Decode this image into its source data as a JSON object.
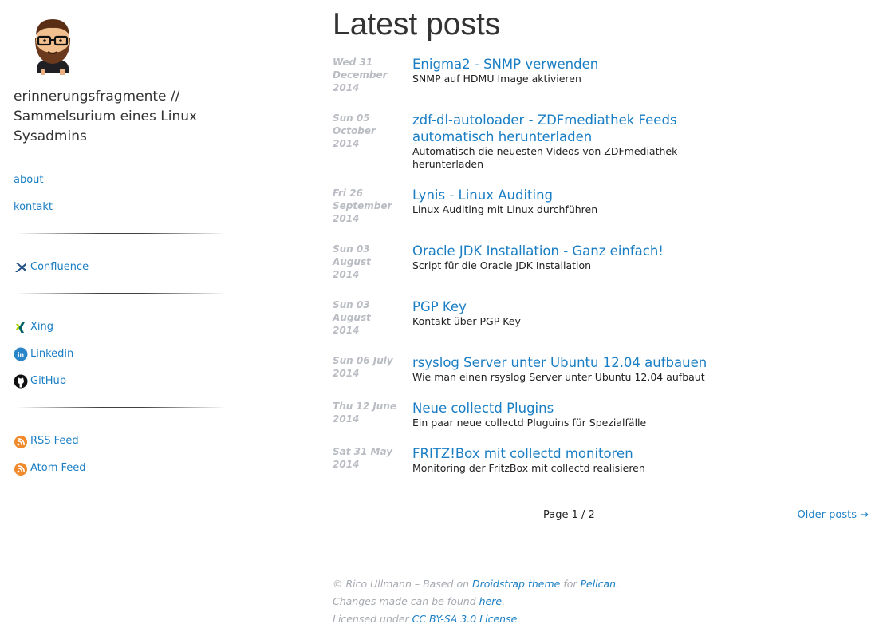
{
  "sidebar": {
    "site_title": "erinnerungsfragmente // Sammelsurium eines Linux Sysadmins",
    "pages": [
      {
        "label": "about"
      },
      {
        "label": "kontakt"
      }
    ],
    "links": [
      {
        "label": "Confluence",
        "icon": "confluence-icon"
      }
    ],
    "social": [
      {
        "label": "Xing",
        "icon": "xing-icon"
      },
      {
        "label": "Linkedin",
        "icon": "linkedin-icon"
      },
      {
        "label": "GitHub",
        "icon": "github-icon"
      }
    ],
    "feeds": [
      {
        "label": "RSS Feed",
        "icon": "rss-icon"
      },
      {
        "label": "Atom Feed",
        "icon": "rss-icon"
      }
    ]
  },
  "main": {
    "heading": "Latest posts",
    "posts": [
      {
        "date": "Wed 31 December 2014",
        "title": "Enigma2 - SNMP verwenden",
        "summary": "SNMP auf HDMU Image aktivieren"
      },
      {
        "date": "Sun 05 October 2014",
        "title": "zdf-dl-autoloader - ZDFmediathek Feeds automatisch herunterladen",
        "summary": "Automatisch die neuesten Videos von ZDFmediathek herunterladen"
      },
      {
        "date": "Fri 26 September 2014",
        "title": "Lynis - Linux Auditing",
        "summary": "Linux Auditing mit Linux durchführen"
      },
      {
        "date": "Sun 03 August 2014",
        "title": "Oracle JDK Installation - Ganz einfach!",
        "summary": "Script für die Oracle JDK Installation"
      },
      {
        "date": "Sun 03 August 2014",
        "title": "PGP Key",
        "summary": "Kontakt über PGP Key"
      },
      {
        "date": "Sun 06 July 2014",
        "title": "rsyslog Server unter Ubuntu 12.04 aufbauen",
        "summary": "Wie man einen rsyslog Server unter Ubuntu 12.04 aufbaut"
      },
      {
        "date": "Thu 12 June 2014",
        "title": "Neue collectd Plugins",
        "summary": "Ein paar neue collectd Pluguins für Spezialfälle"
      },
      {
        "date": "Sat 31 May 2014",
        "title": "FRITZ!Box mit collectd monitoren",
        "summary": "Monitoring der FritzBox mit collectd realisieren"
      }
    ],
    "pagination": {
      "label": "Page 1 / 2",
      "older": "Older posts →"
    }
  },
  "footer": {
    "line1_prefix": "© Rico Ullmann – Based on ",
    "line1_theme": "Droidstrap theme",
    "line1_for": " for ",
    "line1_pelican": "Pelican",
    "line1_end": ".",
    "line2_prefix": "Changes made can be found ",
    "line2_link": "here",
    "line2_end": ".",
    "line3_prefix": "Licensed under ",
    "line3_link": "CC BY-SA 3.0 License",
    "line3_end": "."
  },
  "colors": {
    "link": "#1a7ec4",
    "date": "#b9bcc2",
    "footer": "#a5a9b0",
    "heading": "#333333"
  }
}
